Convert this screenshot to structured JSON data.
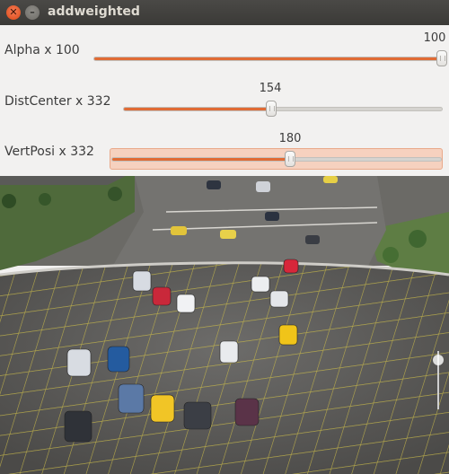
{
  "window": {
    "title": "addweighted"
  },
  "trackbars": [
    {
      "label": "Alpha x 100",
      "value": "100",
      "fraction": 1.0
    },
    {
      "label": "DistCenter x 332",
      "value": "154",
      "fraction": 0.464
    },
    {
      "label": "VertPosi x 332",
      "value": "180",
      "fraction": 0.542
    }
  ],
  "image": {
    "description_icon": "tilt-shift-parking-lot-photo"
  },
  "colors": {
    "accent": "#e06b35",
    "titlebar": "#3b3a37"
  }
}
